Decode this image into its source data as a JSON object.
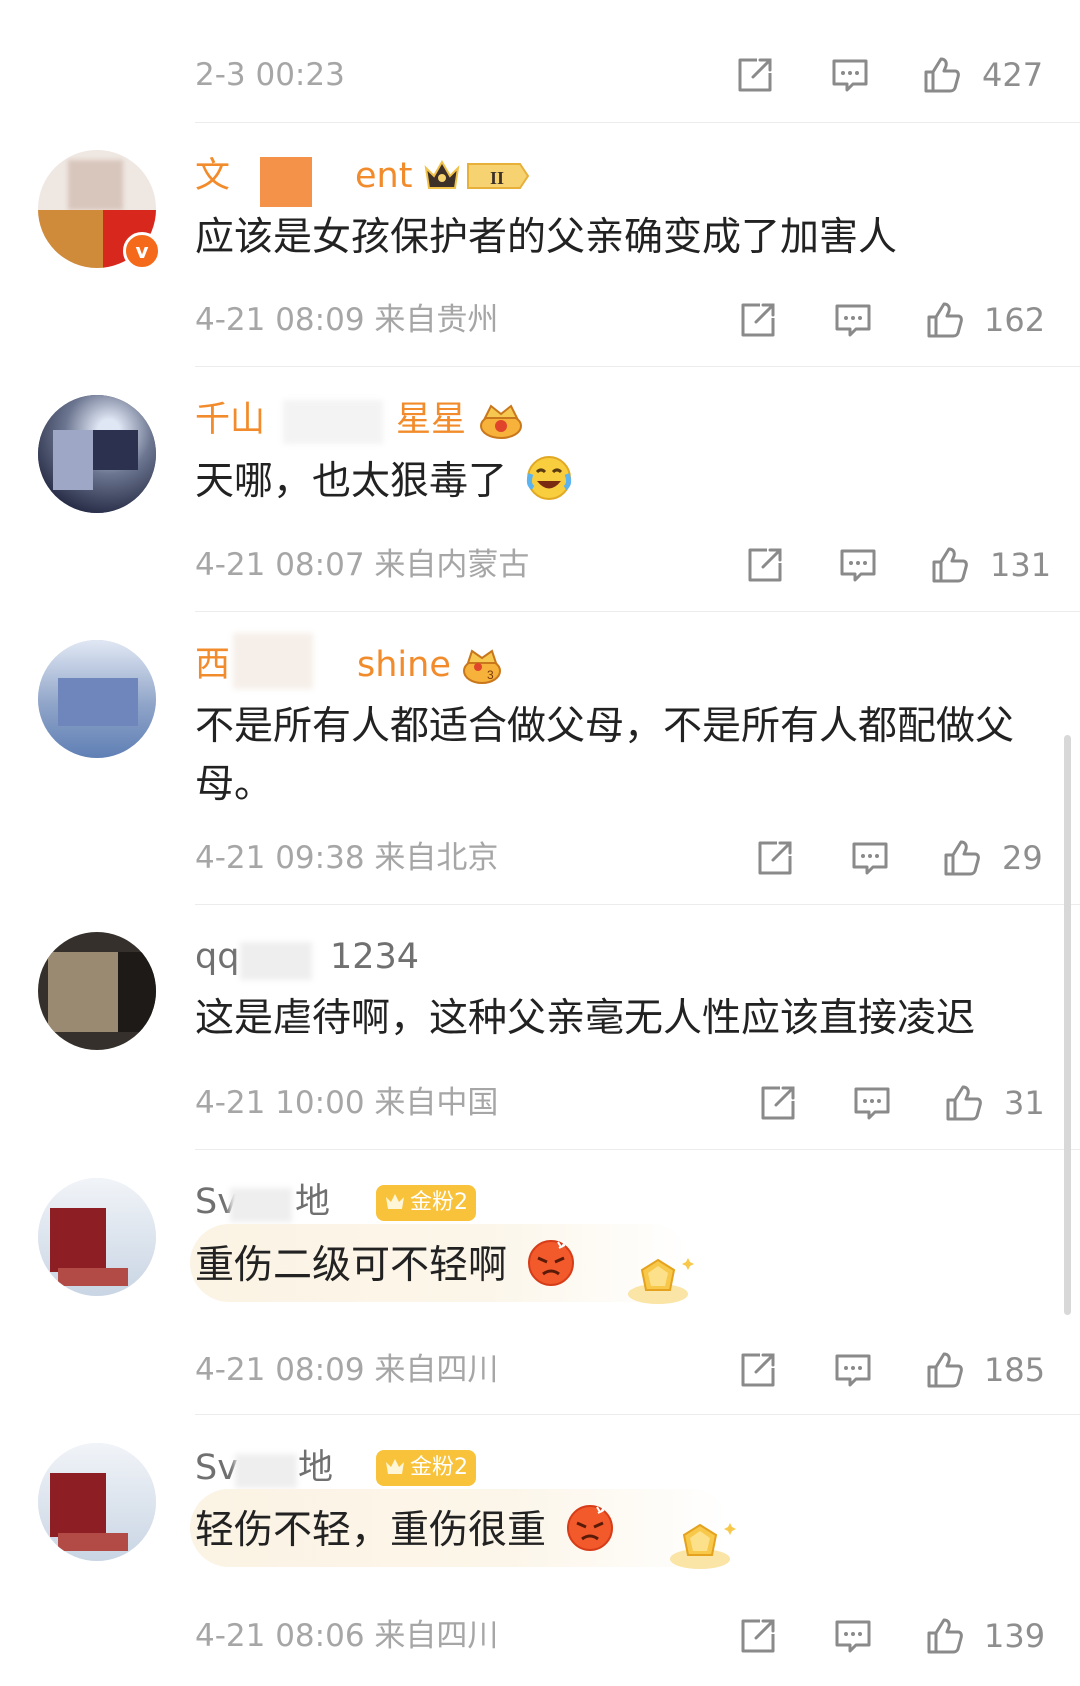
{
  "first_meta": {
    "time": "2-3 00:23",
    "likes": "427"
  },
  "comments": [
    {
      "name_left": "文",
      "name_right": "ent",
      "content": "应该是女孩保护者的父亲确变成了加害人",
      "time": "4-21 08:09 来自贵州",
      "likes": "162",
      "badge": "II"
    },
    {
      "name_left": "千山",
      "name_right": "星星",
      "content": "天哪，也太狠毒了",
      "time": "4-21 08:07 来自内蒙古",
      "likes": "131"
    },
    {
      "name_left": "西",
      "name_right": "shine",
      "content": "不是所有人都适合做父母，不是所有人都配做父母。",
      "time": "4-21 09:38 来自北京",
      "likes": "29"
    },
    {
      "name_left": "qq",
      "name_right": "1234",
      "content": "这是虐待啊，这种父亲毫无人性应该直接凌迟",
      "time": "4-21 10:00 来自中国",
      "likes": "31"
    },
    {
      "name_left": "Sv",
      "name_right": "地",
      "content": "重伤二级可不轻啊",
      "time": "4-21 08:09 来自四川",
      "likes": "185",
      "badge": "金粉2"
    },
    {
      "name_left": "Sv",
      "name_right": "地",
      "content": "轻伤不轻，重伤很重",
      "time": "4-21 08:06 来自四川",
      "likes": "139",
      "badge": "金粉2"
    }
  ],
  "icons": {
    "share": "share-icon",
    "comment": "comment-icon",
    "like": "thumbs-up-icon"
  },
  "colors": {
    "name_orange": "#f28b2b",
    "meta_gray": "#a6a6a6",
    "text": "#222222",
    "fan_badge": "#f8c23a"
  }
}
